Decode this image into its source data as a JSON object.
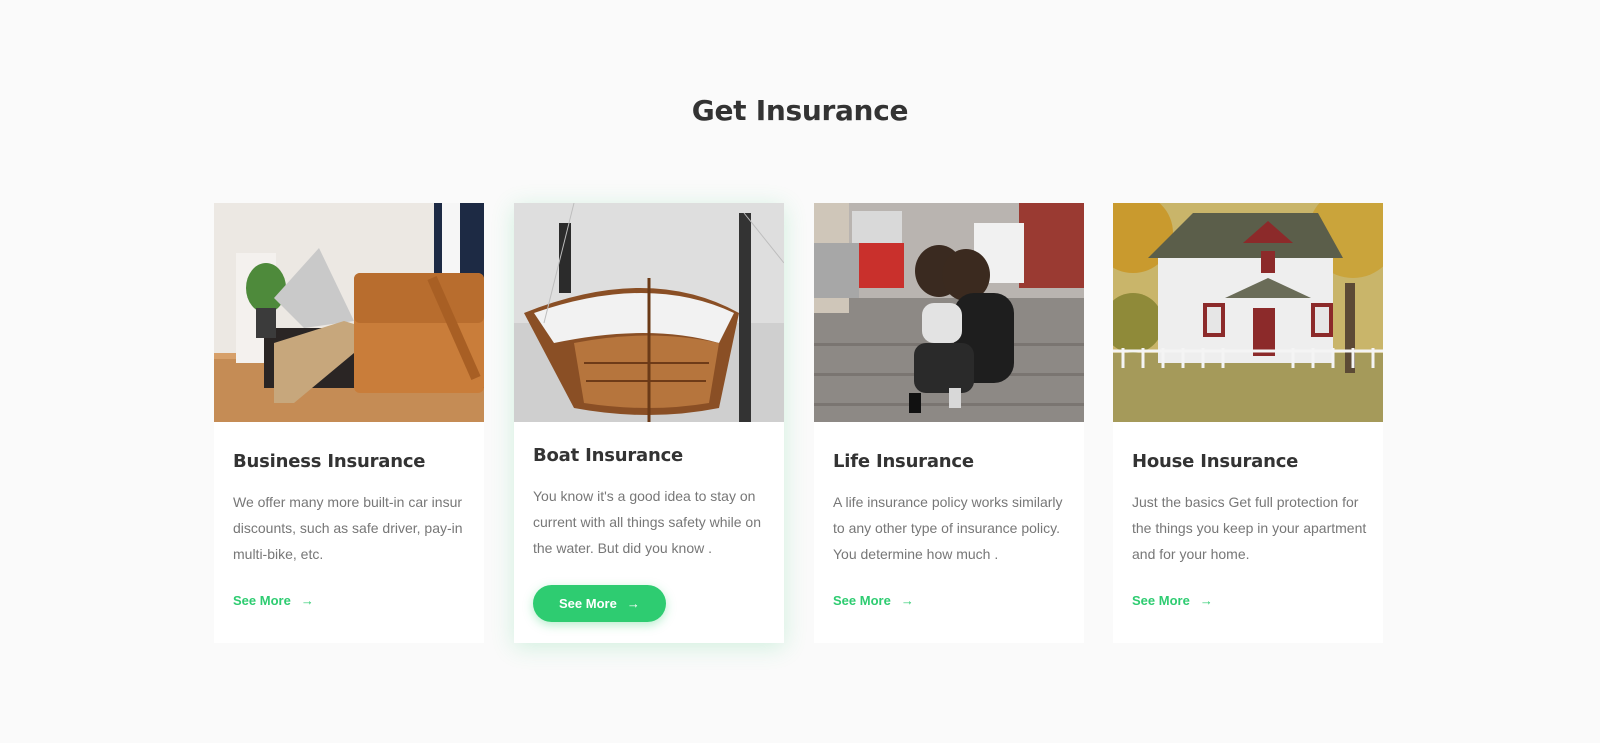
{
  "section": {
    "title": "Get Insurance"
  },
  "accent_color": "#2ecc71",
  "cards": [
    {
      "title": "Business Insurance",
      "description": "We offer many more built-in car insur discounts, such as safe driver, pay-in multi-bike, etc.",
      "link_label": "See More",
      "image": "business-person-with-laptop-and-briefcase"
    },
    {
      "title": "Boat Insurance",
      "description": "You know it's a good idea to stay on current with all things safety while on the water. But did you know .",
      "link_label": "See More",
      "image": "wooden-boat-on-water"
    },
    {
      "title": "Life Insurance",
      "description": "A life insurance policy works similarly to any other type of insurance policy. You determine how much .",
      "link_label": "See More",
      "image": "mother-and-child-on-street"
    },
    {
      "title": "House Insurance",
      "description": "Just the basics Get full protection for  the things you keep in your apartment and for your home.",
      "link_label": "See More",
      "image": "white-house-with-fence"
    }
  ]
}
